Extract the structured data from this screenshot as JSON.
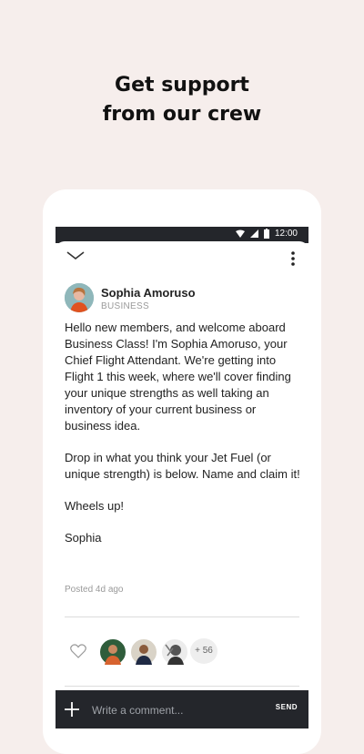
{
  "headline": {
    "line1": "Get support",
    "line2": "from our crew"
  },
  "statusbar": {
    "time": "12:00"
  },
  "post": {
    "author_name": "Sophia Amoruso",
    "author_role": "BUSINESS",
    "paragraphs": [
      "Hello new members, and welcome aboard Business Class! I'm Sophia Amoruso, your Chief Flight Attendant. We're getting into Flight 1 this week, where we'll cover finding your unique strengths as well taking an inventory of your current business or business idea.",
      "Drop in what you think your Jet Fuel (or unique strength) is below. Name and claim it!",
      "Wheels up!",
      "Sophia"
    ],
    "posted": "Posted 4d ago"
  },
  "likes": {
    "more_count": "+ 56"
  },
  "comment": {
    "placeholder": "Write a comment...",
    "send_label": "SEND"
  },
  "colors": {
    "background": "#f6eeec",
    "dark_bar": "#24262b",
    "muted": "#9a9a9a"
  }
}
